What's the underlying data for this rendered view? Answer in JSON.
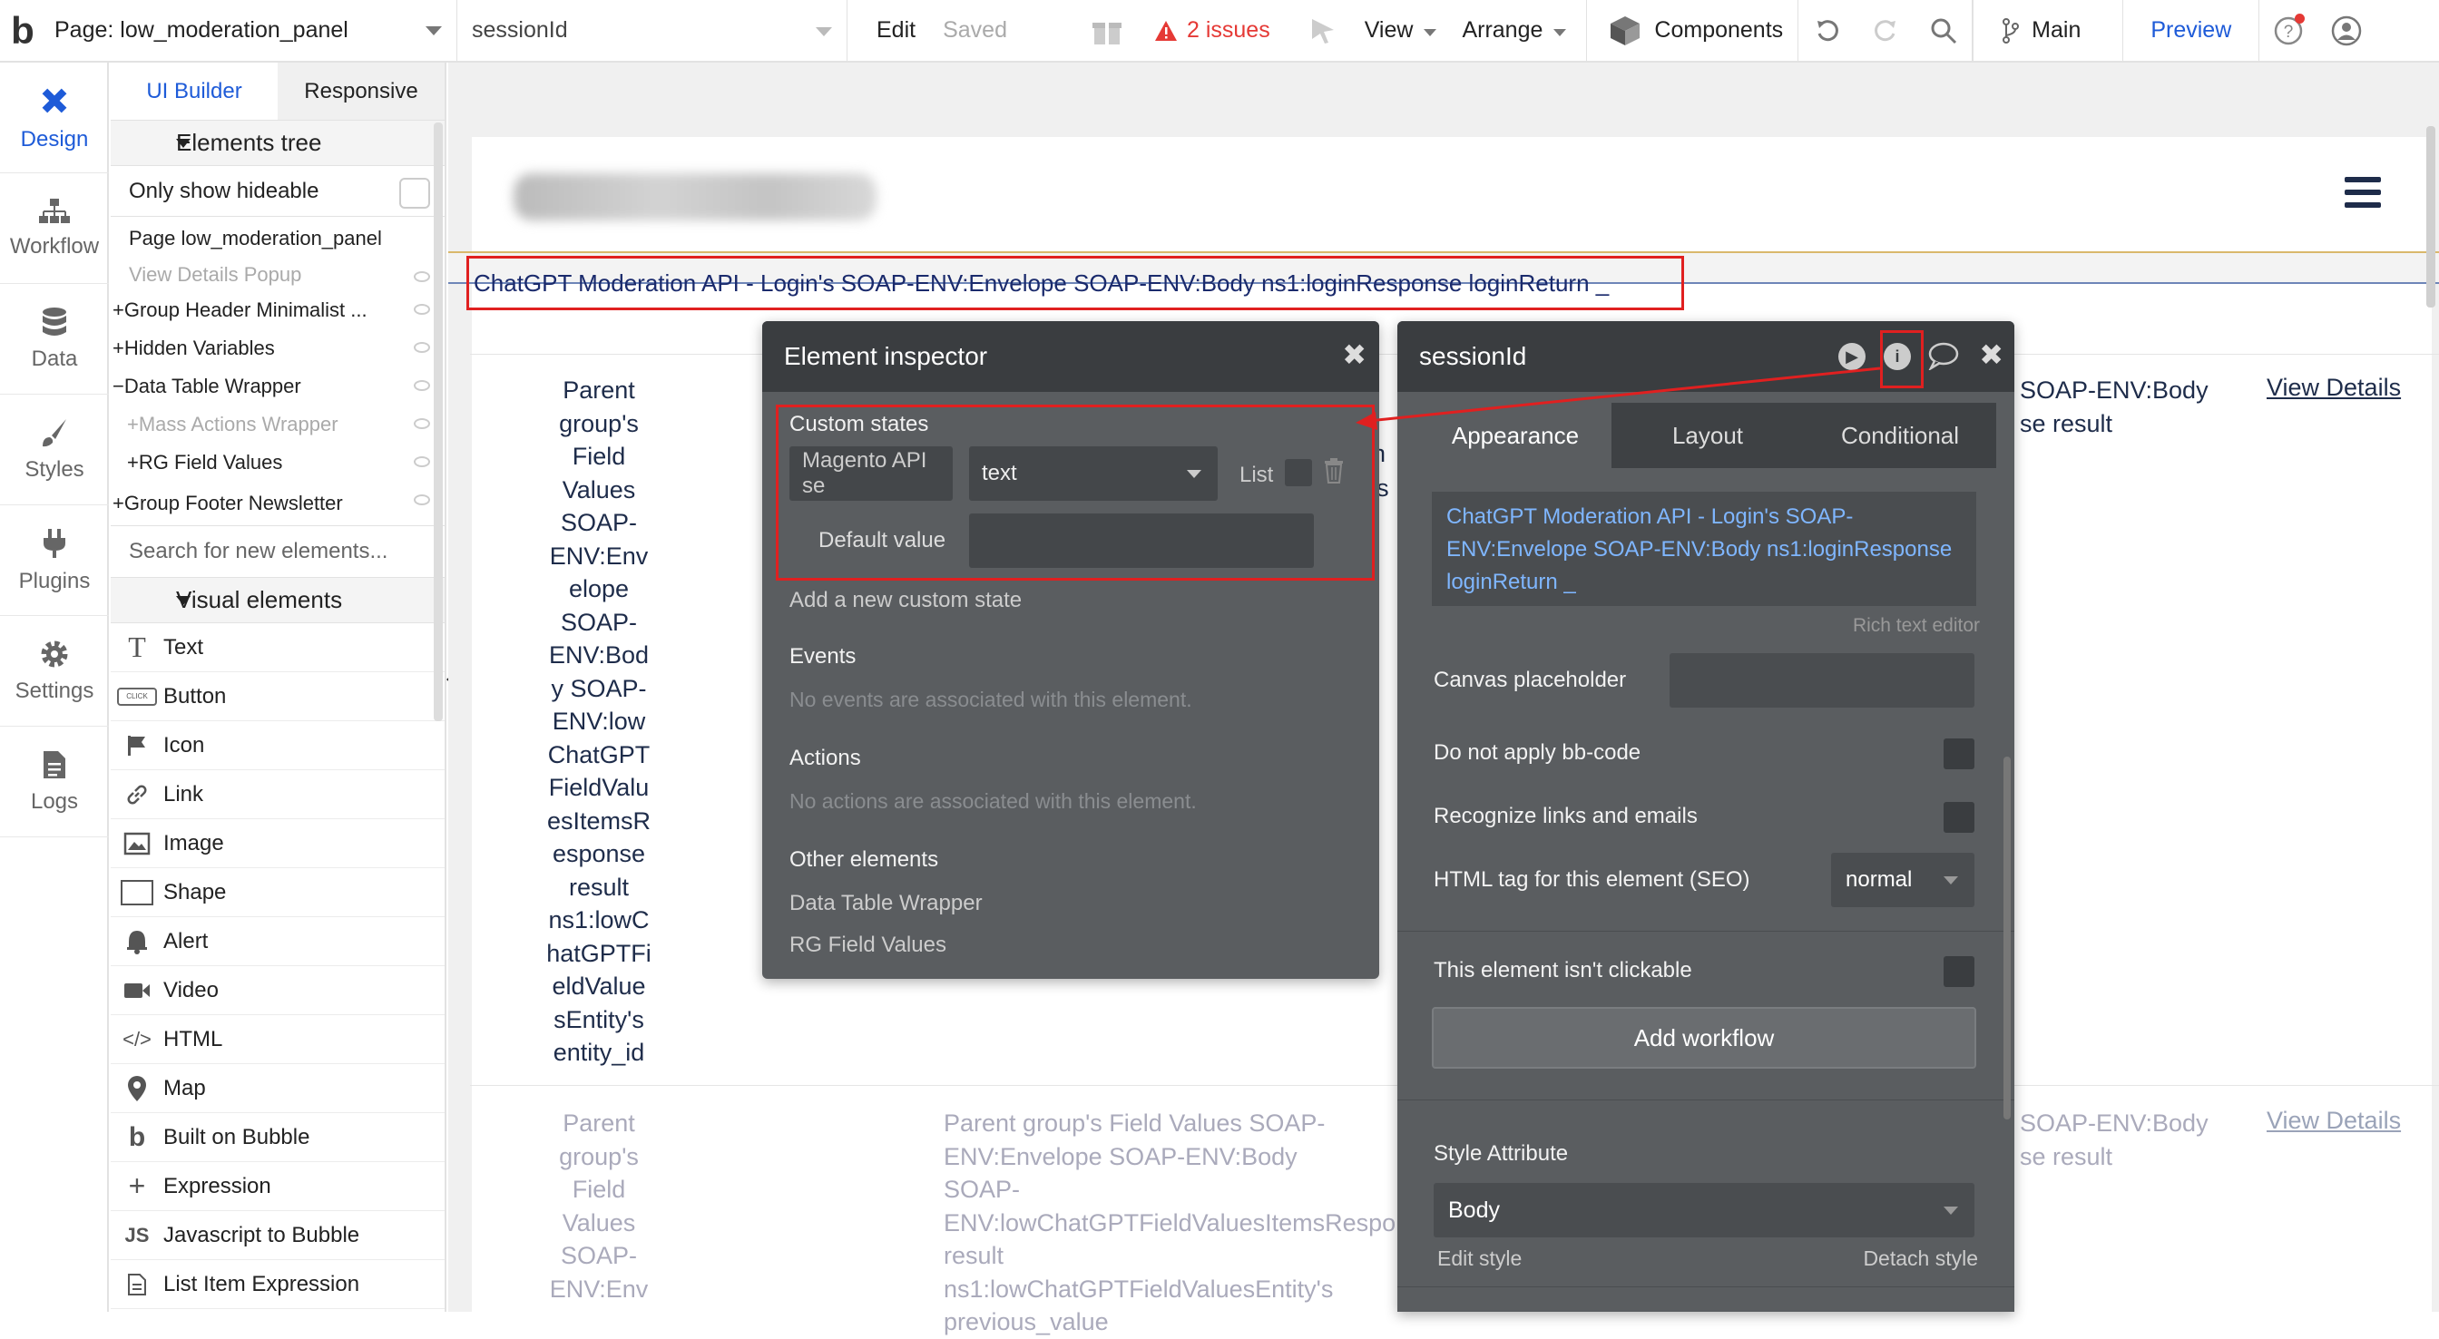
{
  "topbar": {
    "logo": "b",
    "page_label": "Page: low_moderation_panel",
    "element_selector": "sessionId",
    "edit": "Edit",
    "saved": "Saved",
    "issues": "2 issues",
    "view": "View",
    "arrange": "Arrange",
    "components": "Components",
    "branch": "Main",
    "preview": "Preview"
  },
  "rail": {
    "items": [
      {
        "label": "Design",
        "icon": "design-icon"
      },
      {
        "label": "Workflow",
        "icon": "workflow-icon"
      },
      {
        "label": "Data",
        "icon": "data-icon"
      },
      {
        "label": "Styles",
        "icon": "styles-icon"
      },
      {
        "label": "Plugins",
        "icon": "plugins-icon"
      },
      {
        "label": "Settings",
        "icon": "settings-icon"
      },
      {
        "label": "Logs",
        "icon": "logs-icon"
      }
    ]
  },
  "elements_panel": {
    "tabs": [
      "UI Builder",
      "Responsive"
    ],
    "tree_title": "Elements tree",
    "only_hideable": "Only show hideable",
    "tree": [
      {
        "label": "Page low_moderation_panel",
        "prefix": "",
        "dim": false
      },
      {
        "label": "View Details Popup",
        "prefix": "",
        "dim": true
      },
      {
        "label": "Group Header Minimalist ...",
        "prefix": "+",
        "dim": false
      },
      {
        "label": "Hidden Variables",
        "prefix": "+",
        "dim": false
      },
      {
        "label": "Data Table Wrapper",
        "prefix": "−",
        "dim": false
      },
      {
        "label": "Mass Actions Wrapper",
        "prefix": "+",
        "dim": true
      },
      {
        "label": "RG Field Values",
        "prefix": "+",
        "dim": false
      },
      {
        "label": "Group Footer Newsletter",
        "prefix": "+",
        "dim": false
      }
    ],
    "search_placeholder": "Search for new elements...",
    "visual_title": "Visual elements",
    "visual": [
      "Text",
      "Button",
      "Icon",
      "Link",
      "Image",
      "Shape",
      "Alert",
      "Video",
      "HTML",
      "Map",
      "Built on Bubble",
      "Expression",
      "Javascript to Bubble",
      "List Item Expression"
    ]
  },
  "canvas": {
    "banner_text": "ChatGPT Moderation API - Login's SOAP-ENV:Envelope SOAP-ENV:Body ns1:loginResponse loginReturn _",
    "col1_lines": [
      "Parent",
      "group's",
      "Field",
      "Values",
      "SOAP-",
      "ENV:Env",
      "elope",
      "SOAP-",
      "ENV:Bod",
      "y SOAP-",
      "ENV:low",
      "ChatGPT",
      "FieldValu",
      "esItemsR",
      "esponse",
      "result",
      "ns1:lowC",
      "hatGPTFi",
      "eldValue",
      "sEntity's",
      "entity_id"
    ],
    "col1_dim_lines": [
      "Parent",
      "group's",
      "Field",
      "Values",
      "SOAP-",
      "ENV:Env"
    ],
    "col2_dim_lines": [
      "Parent group's Field Values SOAP-",
      "ENV:Envelope SOAP-ENV:Body SOAP-",
      "ENV:lowChatGPTFieldValuesItemsRespon",
      "result ns1:lowChatGPTFieldValuesEntity's",
      "previous_value"
    ],
    "right_col_lines": [
      "SOAP-ENV:Body",
      "se result"
    ],
    "right_col_dim_lines": [
      "SOAP-ENV:Body",
      "se result"
    ],
    "partial_n": "n",
    "partial_s": "'s",
    "view_details": "View Details"
  },
  "inspector": {
    "title": "Element inspector",
    "custom_states": "Custom states",
    "state_name": "Magento API se",
    "state_type": "text",
    "list_label": "List",
    "default_value_label": "Default value",
    "add_state": "Add a new custom state",
    "events_title": "Events",
    "events_empty": "No events are associated with this element.",
    "actions_title": "Actions",
    "actions_empty": "No actions are associated with this element.",
    "other_title": "Other elements",
    "other": [
      "Data Table Wrapper",
      "RG Field Values"
    ]
  },
  "props": {
    "title": "sessionId",
    "tabs": [
      "Appearance",
      "Layout",
      "Conditional"
    ],
    "rte_text": "ChatGPT Moderation API - Login's SOAP-ENV:Envelope SOAP-ENV:Body ns1:loginResponse loginReturn _",
    "rte_label": "Rich text editor",
    "canvas_placeholder": "Canvas placeholder",
    "no_bbcode": "Do not apply bb-code",
    "recognize_links": "Recognize links and emails",
    "html_tag_label": "HTML tag for this element (SEO)",
    "html_tag_value": "normal",
    "not_clickable": "This element isn't clickable",
    "add_workflow": "Add workflow",
    "style_attribute": "Style Attribute",
    "style_value": "Body",
    "edit_style": "Edit style",
    "detach_style": "Detach style"
  },
  "colors": {
    "accent": "#1e5bd8",
    "alert": "#e02020",
    "panel": "#5a5d60",
    "panel_head": "#3a3d40"
  }
}
